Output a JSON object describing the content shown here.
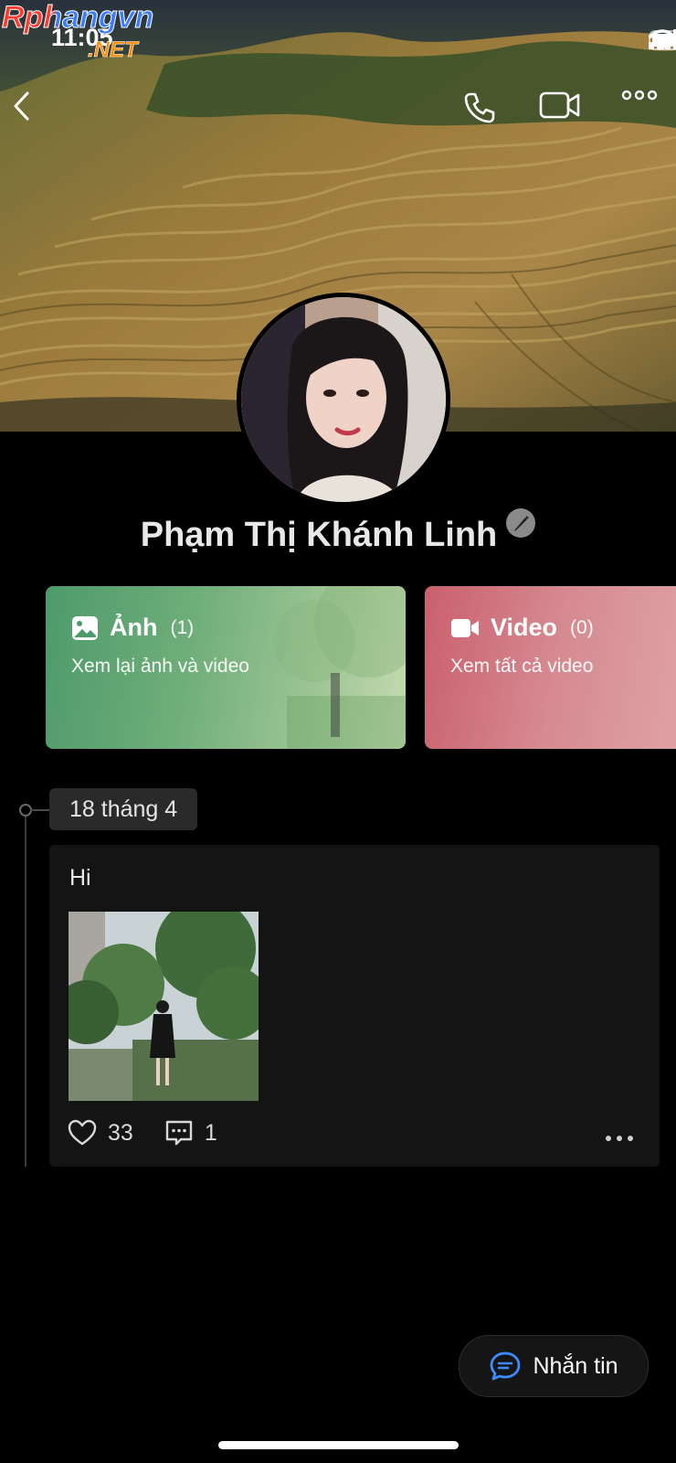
{
  "status_bar": {
    "time": "11:05"
  },
  "watermark": {
    "line1": "Rphangvn",
    "line2": ".NET"
  },
  "nav": {
    "back_icon": "chevron-left-icon",
    "call_icon": "phone-icon",
    "video_icon": "video-camera-icon",
    "more_icon": "more-horizontal-icon"
  },
  "profile": {
    "name": "Phạm Thị Khánh Linh",
    "edit_icon": "pencil-icon"
  },
  "media_cards": [
    {
      "title": "Ảnh",
      "count": "(1)",
      "subtitle": "Xem lại ảnh và video",
      "icon": "image-icon",
      "color": "#4e9a6a"
    },
    {
      "title": "Video",
      "count": "(0)",
      "subtitle": "Xem tất cả video",
      "icon": "video-icon",
      "color": "#c9606d"
    }
  ],
  "timeline": {
    "date": "18 tháng 4",
    "post": {
      "text": "Hi",
      "likes": "33",
      "comments": "1",
      "like_icon": "heart-icon",
      "comment_icon": "comment-icon"
    }
  },
  "message_button": {
    "label": "Nhắn tin",
    "icon": "chat-bubble-icon",
    "accent": "#3d8bff"
  }
}
